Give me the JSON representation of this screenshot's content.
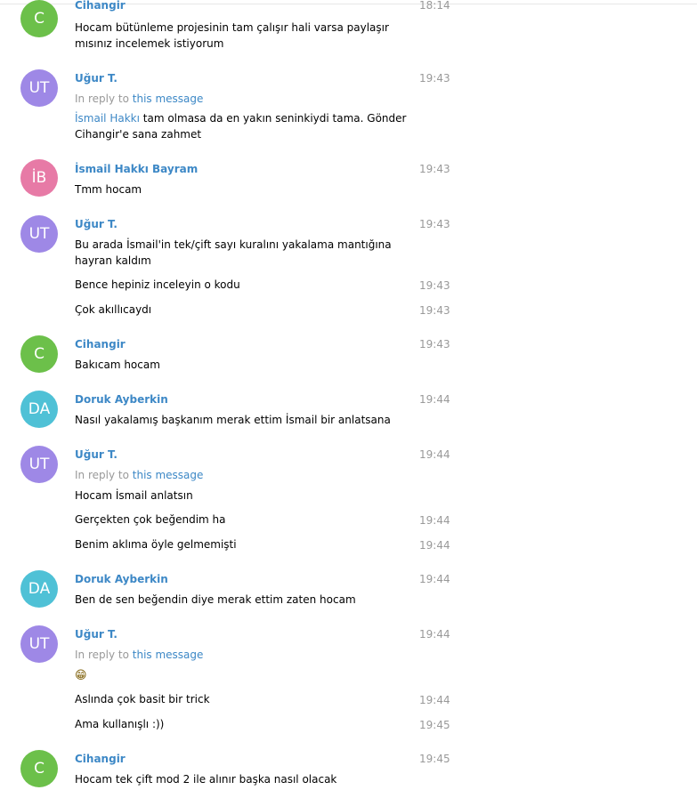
{
  "colors": {
    "link": "#3d88c6",
    "time": "#999999",
    "avatar_green": "#6cc04a",
    "avatar_purple": "#9e88e6",
    "avatar_pink": "#e77aa6",
    "avatar_teal": "#4fc1d6"
  },
  "messages": [
    {
      "avatar": "C",
      "avatar_color": "green",
      "author": "Cihangir",
      "time": "18:14",
      "text": "Hocam bütünleme projesinin tam çalışır hali varsa paylaşır mısınız incelemek istiyorum"
    },
    {
      "avatar": "UT",
      "avatar_color": "purple",
      "author": "Uğur T.",
      "time": "19:43",
      "reply_prefix": "In reply to",
      "reply_link": "this message",
      "mention": "İsmail Hakkı",
      "text": "tam olmasa da en yakın seninkiydi tama. Gönder Cihangir'e sana zahmet"
    },
    {
      "avatar": "İB",
      "avatar_color": "pink",
      "author": "İsmail Hakkı Bayram",
      "time": "19:43",
      "text": "Tmm hocam"
    },
    {
      "avatar": "UT",
      "avatar_color": "purple",
      "author": "Uğur T.",
      "time": "19:43",
      "text": "Bu arada İsmail'in tek/çift sayı kuralını yakalama mantığına hayran kaldım"
    },
    {
      "text": "Bence hepiniz inceleyin o kodu",
      "time": "19:43"
    },
    {
      "text": "Çok akıllıcaydı",
      "time": "19:43"
    },
    {
      "avatar": "C",
      "avatar_color": "green",
      "author": "Cihangir",
      "time": "19:43",
      "text": "Bakıcam hocam"
    },
    {
      "avatar": "DA",
      "avatar_color": "teal",
      "author": "Doruk Ayberkin",
      "time": "19:44",
      "text": "Nasıl yakalamış başkanım merak ettim İsmail bir anlatsana"
    },
    {
      "avatar": "UT",
      "avatar_color": "purple",
      "author": "Uğur T.",
      "time": "19:44",
      "reply_prefix": "In reply to",
      "reply_link": "this message",
      "text": "Hocam İsmail anlatsın"
    },
    {
      "text": "Gerçekten çok beğendim ha",
      "time": "19:44"
    },
    {
      "text": "Benim aklıma öyle gelmemişti",
      "time": "19:44"
    },
    {
      "avatar": "DA",
      "avatar_color": "teal",
      "author": "Doruk Ayberkin",
      "time": "19:44",
      "text": "Ben de sen beğendin diye merak ettim zaten hocam"
    },
    {
      "avatar": "UT",
      "avatar_color": "purple",
      "author": "Uğur T.",
      "time": "19:44",
      "reply_prefix": "In reply to",
      "reply_link": "this message",
      "emoji": "😁",
      "emoji_icon": "grinning-face-icon"
    },
    {
      "text": "Aslında çok basit bir trick",
      "time": "19:44"
    },
    {
      "text": "Ama kullanışlı :))",
      "time": "19:45"
    },
    {
      "avatar": "C",
      "avatar_color": "green",
      "author": "Cihangir",
      "time": "19:45",
      "text": "Hocam tek çift mod 2 ile alınır başka nasıl olacak"
    }
  ]
}
